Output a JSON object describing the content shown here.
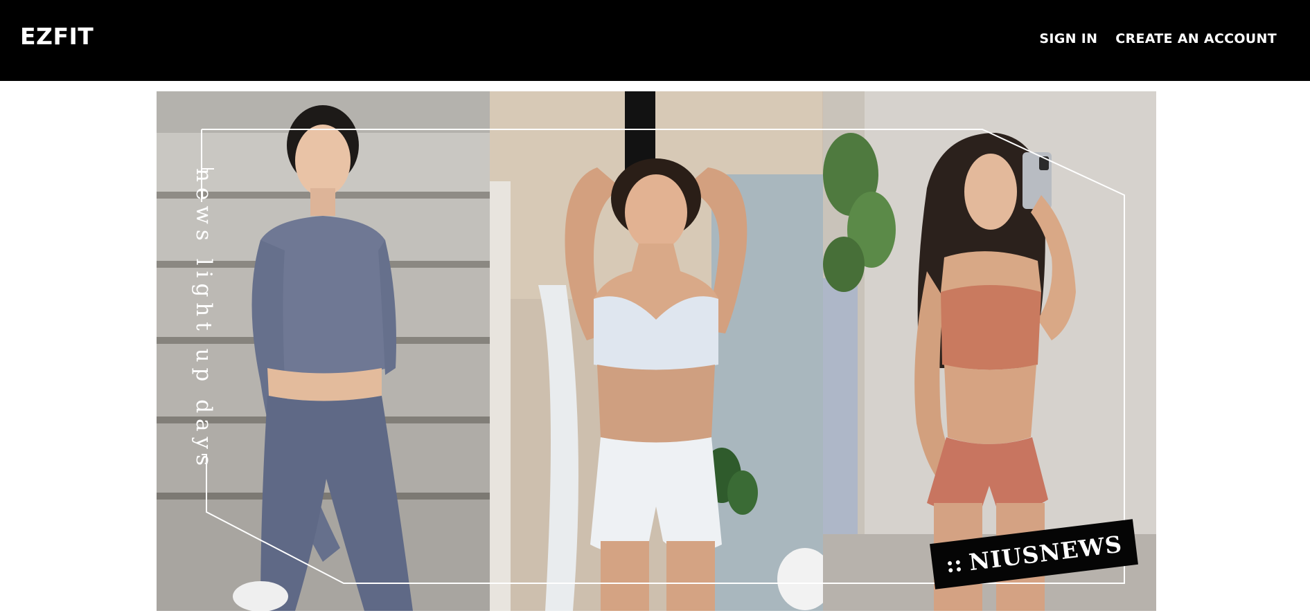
{
  "header": {
    "logo_text": "EZFIT",
    "nav": {
      "sign_in_label": "SIGN IN",
      "create_account_label": "CREATE AN ACCOUNT"
    }
  },
  "banner": {
    "vertical_text": "news light up days",
    "stamp_dots": "::",
    "stamp_name": "NIUSNEWS"
  },
  "colors": {
    "header_bg": "#000000",
    "header_text": "#ffffff",
    "page_bg": "#ffffff"
  }
}
